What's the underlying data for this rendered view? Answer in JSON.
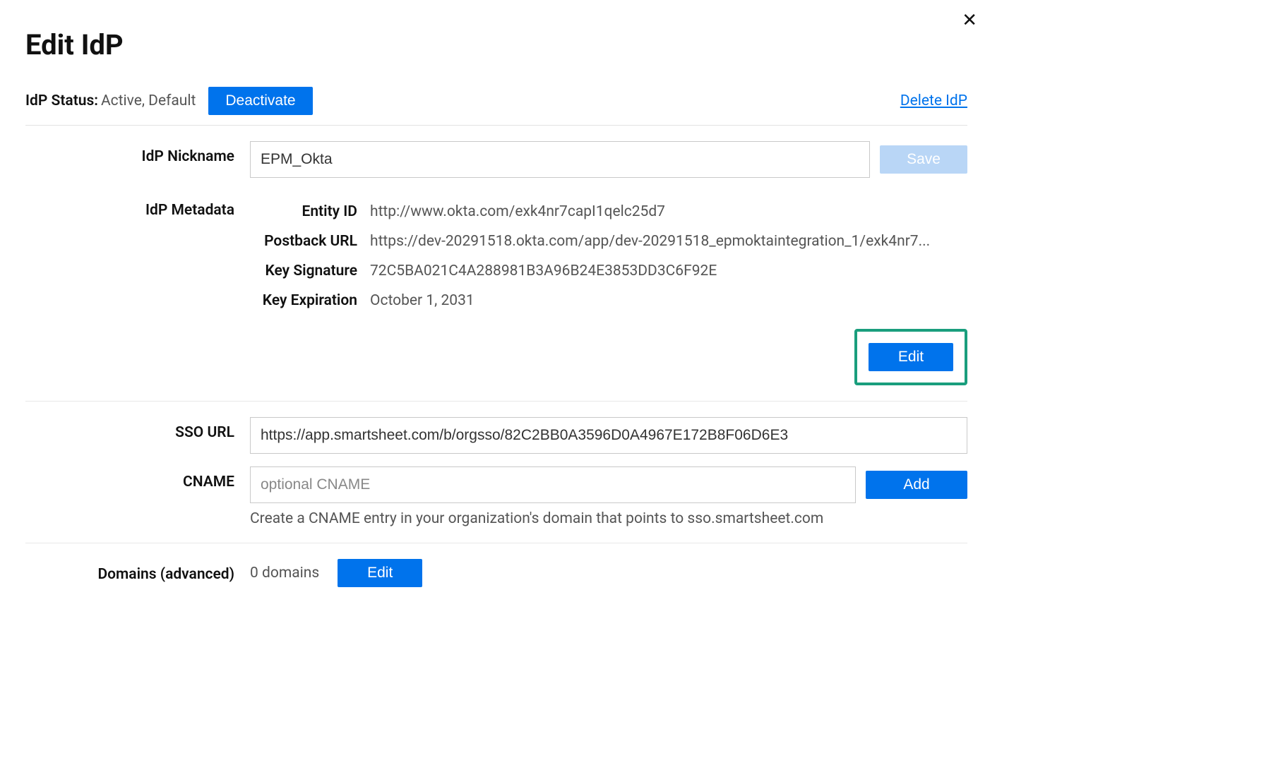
{
  "title": "Edit IdP",
  "status": {
    "label": "IdP Status:",
    "value": "Active, Default",
    "deactivate_btn": "Deactivate",
    "delete_link": "Delete IdP"
  },
  "nickname": {
    "label": "IdP Nickname",
    "value": "EPM_Okta",
    "save_btn": "Save"
  },
  "metadata": {
    "label": "IdP Metadata",
    "entity_id_label": "Entity ID",
    "entity_id_value": "http://www.okta.com/exk4nr7capI1qelc25d7",
    "postback_label": "Postback URL",
    "postback_value": "https://dev-20291518.okta.com/app/dev-20291518_epmoktaintegration_1/exk4nr7...",
    "key_sig_label": "Key Signature",
    "key_sig_value": "72C5BA021C4A288981B3A96B24E3853DD3C6F92E",
    "key_exp_label": "Key Expiration",
    "key_exp_value": "October 1, 2031",
    "edit_btn": "Edit"
  },
  "sso": {
    "label": "SSO URL",
    "value": "https://app.smartsheet.com/b/orgsso/82C2BB0A3596D0A4967E172B8F06D6E3"
  },
  "cname": {
    "label": "CNAME",
    "placeholder": "optional CNAME",
    "add_btn": "Add",
    "help": "Create a CNAME entry in your organization's domain that points to sso.smartsheet.com"
  },
  "domains": {
    "label": "Domains (advanced)",
    "value": "0 domains",
    "edit_btn": "Edit"
  }
}
